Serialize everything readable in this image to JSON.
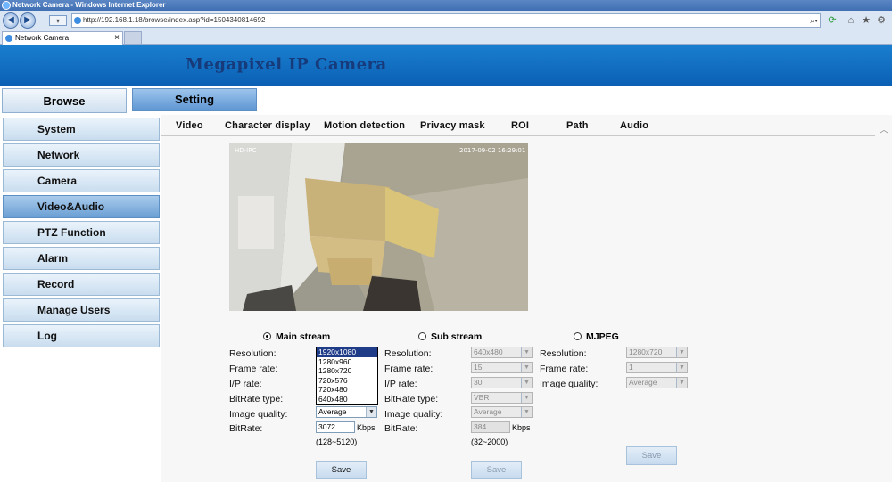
{
  "browser": {
    "title": "Network Camera - Windows Internet Explorer",
    "url": "http://192.168.1.18/browse/index.asp?id=1504340814692",
    "tab": "Network Camera"
  },
  "banner": {
    "title": "Megapixel IP Camera"
  },
  "nav": {
    "browse": "Browse",
    "setting": "Setting"
  },
  "sidebar": {
    "items": [
      {
        "label": "System"
      },
      {
        "label": "Network"
      },
      {
        "label": "Camera"
      },
      {
        "label": "Video&Audio",
        "active": true
      },
      {
        "label": "PTZ Function"
      },
      {
        "label": "Alarm"
      },
      {
        "label": "Record"
      },
      {
        "label": "Manage Users"
      },
      {
        "label": "Log"
      }
    ]
  },
  "subtabs": [
    "Video",
    "Character display",
    "Motion detection",
    "Privacy mask",
    "ROI",
    "Path",
    "Audio"
  ],
  "video": {
    "timestamp": "2017-09-02  16:29:01",
    "osd_name": "HD-IPC"
  },
  "streams": {
    "main": {
      "label": "Main stream",
      "selected": true,
      "resolution_label": "Resolution:",
      "resolution": "1920x1080",
      "resolution_options": [
        "1920x1080",
        "1280x960",
        "1280x720",
        "720x576",
        "720x480",
        "640x480"
      ],
      "frame_rate_label": "Frame rate:",
      "ip_rate_label": "I/P rate:",
      "bitrate_type_label": "BitRate type:",
      "image_quality_label": "Image quality:",
      "image_quality": "Average",
      "bitrate_label": "BitRate:",
      "bitrate": "3072",
      "unit": "Kbps",
      "range": "(128~5120)",
      "save": "Save"
    },
    "sub": {
      "label": "Sub stream",
      "selected": false,
      "resolution_label": "Resolution:",
      "resolution": "640x480",
      "frame_rate_label": "Frame rate:",
      "frame_rate": "15",
      "ip_rate_label": "I/P rate:",
      "ip_rate": "30",
      "bitrate_type_label": "BitRate type:",
      "bitrate_type": "VBR",
      "image_quality_label": "Image quality:",
      "image_quality": "Average",
      "bitrate_label": "BitRate:",
      "bitrate": "384",
      "unit": "Kbps",
      "range": "(32~2000)",
      "save": "Save"
    },
    "mjpeg": {
      "label": "MJPEG",
      "selected": false,
      "resolution_label": "Resolution:",
      "resolution": "1280x720",
      "frame_rate_label": "Frame rate:",
      "frame_rate": "1",
      "image_quality_label": "Image quality:",
      "image_quality": "Average",
      "save": "Save"
    }
  },
  "colors": {
    "banner": "#0b6cc0",
    "active_tab": "#6a9fd4",
    "highlight": "#1f3c88"
  }
}
